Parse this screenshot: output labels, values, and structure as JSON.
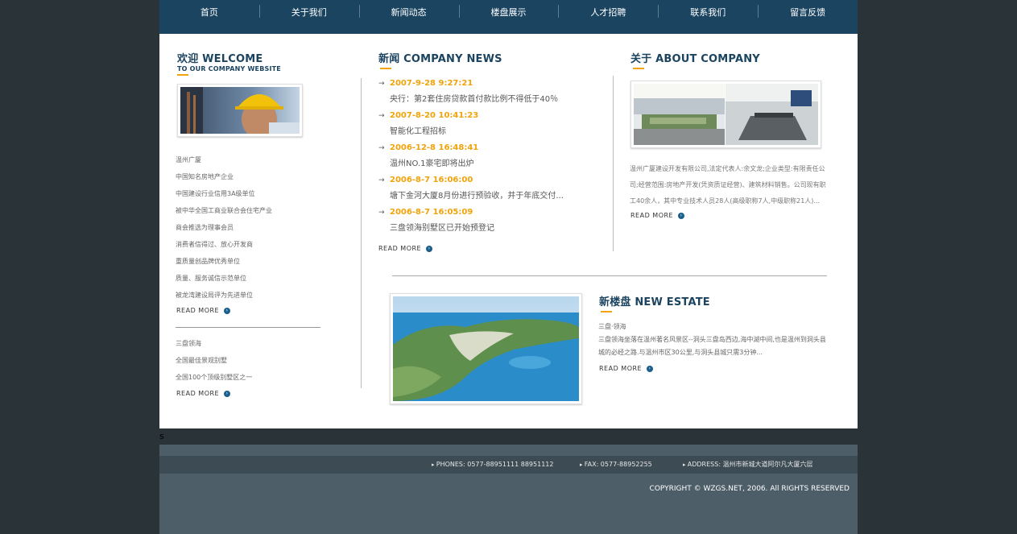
{
  "nav": [
    "首页",
    "关于我们",
    "新闻动态",
    "楼盘展示",
    "人才招聘",
    "联系我们",
    "留言反馈"
  ],
  "welcome": {
    "title": "欢迎 WELCOME",
    "subtitle": "TO OUR COMPANY WEBSITE"
  },
  "left_list_1": [
    "温州广厦",
    "中国知名房地产企业",
    "中国建设行业信用3A级单位",
    "被中华全国工商业联合会住宅产业",
    "商会推选为理事会员",
    "消费者信得过、放心开发商",
    "重质量创品牌优秀单位",
    "质量、服务诚信示范单位",
    "被龙湾建设局评为先进单位"
  ],
  "left_list_2": [
    "三盘领海",
    "全国最佳景观别墅",
    "全国100个顶级别墅区之一"
  ],
  "readmore": "READ MORE",
  "news": {
    "title": "新闻 COMPANY NEWS",
    "items": [
      {
        "date": "2007-9-28 9:27:21",
        "title": "央行：第2套住房贷款首付款比例不得低于40％"
      },
      {
        "date": "2007-8-20 10:41:23",
        "title": "智能化工程招标"
      },
      {
        "date": "2006-12-8 16:48:41",
        "title": "温州NO.1豪宅即将出炉"
      },
      {
        "date": "2006-8-7 16:06:00",
        "title": "塘下金河大厦8月份进行预验收，并于年底交付..."
      },
      {
        "date": "2006-8-7 16:05:09",
        "title": "三盘领海别墅区已开始预登记"
      }
    ]
  },
  "about": {
    "title": "关于 ABOUT COMPANY",
    "text": "温州广厦建设开发有限公司,法定代表人:余文龙;企业类型:有限责任公司;经营范围:房地产开发(凭资质证经营)、建筑材料销售。公司现有职工40余人，其中专业技术人员28人(高级职称7人,中级职称21人)..."
  },
  "estate": {
    "title": "新楼盘 NEW ESTATE",
    "name": "三盘·领海",
    "text": "三盘领海坐落在温州著名风景区--洞头三盘岛西边,海中湖中间,也是温州到洞头县城的必经之路.与温州市区30公里,与洞头县城只需3分钟..."
  },
  "s_mark": "s",
  "footer": {
    "phones": "PHONES: 0577-88951111  88951112",
    "fax": "FAX: 0577-88952255",
    "address": "ADDRESS: 温州市新城大道阿尔凡大厦六层",
    "copyright": "COPYRIGHT © WZGS.NET, 2006. All RIGHTS RESERVED"
  },
  "colors": {
    "nav_bg": "#1b4460",
    "accent": "#f0a30a",
    "page_bg": "#2a3338"
  }
}
